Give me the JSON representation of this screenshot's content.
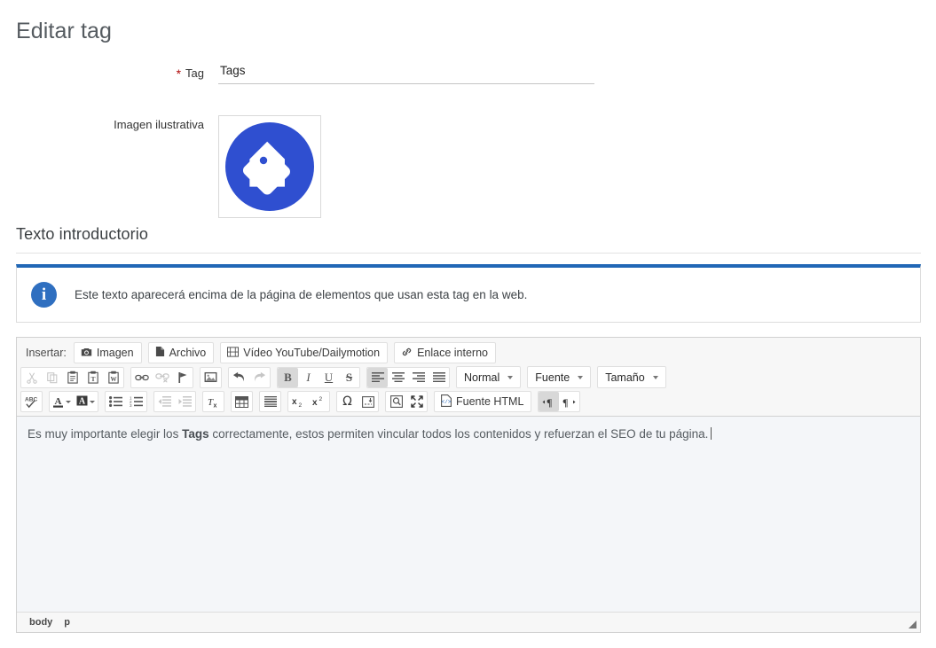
{
  "page": {
    "title": "Editar tag"
  },
  "form": {
    "tag": {
      "label": "Tag",
      "required_marker": "*",
      "value": "Tags",
      "placeholder": "Tags"
    },
    "image": {
      "label": "Imagen ilustrativa",
      "icon": "tag-icon",
      "icon_color": "#2f4fd0"
    }
  },
  "section": {
    "heading": "Texto introductorio"
  },
  "alert": {
    "icon": "info-icon",
    "icon_glyph": "i",
    "accent_color": "#2167b6",
    "message": "Este texto aparecerá encima de la página de elementos que usan esta tag en la web."
  },
  "editor": {
    "insert_row": {
      "caption": "Insertar:",
      "buttons": [
        {
          "label": "Imagen",
          "icon": "camera-icon"
        },
        {
          "label": "Archivo",
          "icon": "file-icon"
        },
        {
          "label": "Vídeo YouTube/Dailymotion",
          "icon": "film-icon"
        },
        {
          "label": "Enlace interno",
          "icon": "chain-icon"
        }
      ]
    },
    "toolbar_row2": {
      "clipboard": [
        {
          "name": "cut",
          "title": "Cortar",
          "state": "dim"
        },
        {
          "name": "copy",
          "title": "Copiar",
          "state": "dim"
        },
        {
          "name": "paste",
          "title": "Pegar",
          "state": "normal"
        },
        {
          "name": "paste-text",
          "title": "Pegar como texto sin formato",
          "state": "normal"
        },
        {
          "name": "paste-word",
          "title": "Pegar desde Word",
          "state": "normal"
        }
      ],
      "links": [
        {
          "name": "link",
          "title": "Enlace",
          "state": "normal"
        },
        {
          "name": "unlink",
          "title": "Eliminar enlace",
          "state": "dim"
        },
        {
          "name": "anchor",
          "title": "Anclaje",
          "state": "normal"
        }
      ],
      "media": [
        {
          "name": "image",
          "title": "Imagen",
          "state": "normal"
        }
      ],
      "history": [
        {
          "name": "undo",
          "title": "Deshacer",
          "state": "normal"
        },
        {
          "name": "redo",
          "title": "Rehacer",
          "state": "dim"
        }
      ],
      "basic_styles": [
        {
          "name": "bold",
          "title": "Negrita",
          "glyph": "B",
          "state": "on"
        },
        {
          "name": "italic",
          "title": "Cursiva",
          "glyph": "I",
          "state": "normal"
        },
        {
          "name": "underline",
          "title": "Subrayado",
          "glyph": "U",
          "state": "normal"
        },
        {
          "name": "strike",
          "title": "Tachado",
          "glyph": "S",
          "state": "normal"
        }
      ],
      "align": [
        {
          "name": "align-left",
          "title": "Alinear a la izquierda",
          "state": "on"
        },
        {
          "name": "align-center",
          "title": "Centrar",
          "state": "normal"
        },
        {
          "name": "align-right",
          "title": "Alinear a la derecha",
          "state": "normal"
        },
        {
          "name": "justify",
          "title": "Justificado",
          "state": "normal"
        }
      ],
      "combos": [
        {
          "name": "paragraph-format",
          "label": "Normal"
        },
        {
          "name": "font-family",
          "label": "Fuente"
        },
        {
          "name": "font-size",
          "label": "Tamaño"
        }
      ]
    },
    "toolbar_row3": {
      "spellcheck": [
        {
          "name": "spellcheck",
          "title": "Revisar ortografía",
          "glyph": "ABC"
        }
      ],
      "colors": [
        {
          "name": "text-color",
          "title": "Color de texto"
        },
        {
          "name": "background-color",
          "title": "Color de fondo"
        }
      ],
      "lists": [
        {
          "name": "bulleted-list",
          "title": "Lista de viñetas"
        },
        {
          "name": "numbered-list",
          "title": "Lista numerada"
        }
      ],
      "indent": [
        {
          "name": "outdent",
          "title": "Reducir sangría",
          "state": "dim"
        },
        {
          "name": "indent",
          "title": "Aumentar sangría",
          "state": "dim"
        }
      ],
      "remove_format": [
        {
          "name": "remove-format",
          "title": "Eliminar formato",
          "glyph": "Tx"
        }
      ],
      "table": [
        {
          "name": "table",
          "title": "Tabla"
        }
      ],
      "rule": [
        {
          "name": "horizontal-rule",
          "title": "Línea horizontal"
        }
      ],
      "scripts": [
        {
          "name": "subscript",
          "title": "Subíndice",
          "glyph": "x₂"
        },
        {
          "name": "superscript",
          "title": "Superíndice",
          "glyph": "x²"
        }
      ],
      "special": [
        {
          "name": "special-char",
          "title": "Carácter especial",
          "glyph": "Ω"
        },
        {
          "name": "page-break",
          "title": "Salto de página"
        }
      ],
      "view": [
        {
          "name": "preview",
          "title": "Vista previa"
        },
        {
          "name": "maximize",
          "title": "Maximizar"
        }
      ],
      "source_button": {
        "label": "Fuente HTML",
        "icon": "source-icon"
      },
      "direction": [
        {
          "name": "ltr",
          "title": "Dirección izquierda a derecha",
          "glyph": "¶",
          "state": "on"
        },
        {
          "name": "rtl",
          "title": "Dirección derecha a izquierda",
          "glyph": "¶",
          "state": "normal"
        }
      ]
    },
    "content": {
      "text_before": "Es muy importante elegir los ",
      "bold_text": "Tags",
      "text_after": " correctamente, estos permiten vincular todos los contenidos y refuerzan el SEO de tu página."
    },
    "statusbar": {
      "path": [
        "body",
        "p"
      ],
      "resize_handle": "resize-grip-icon"
    }
  }
}
